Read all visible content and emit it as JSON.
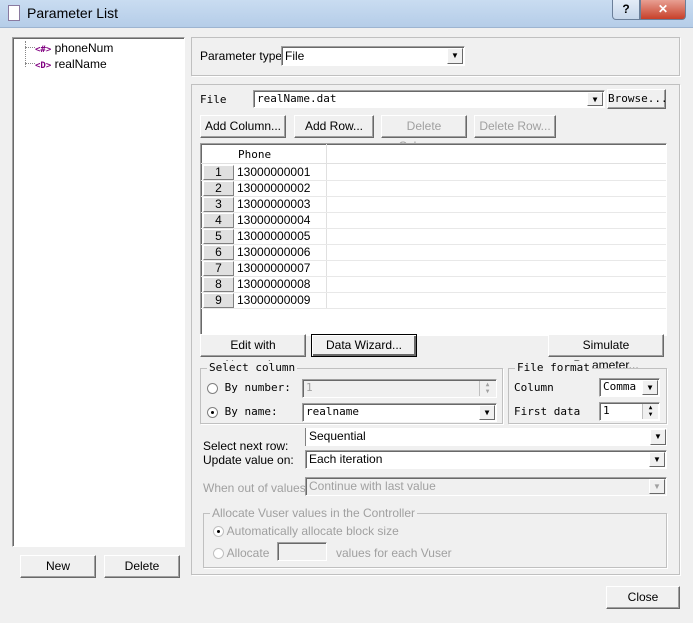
{
  "window": {
    "title": "Parameter List",
    "help": "?",
    "close": "✕"
  },
  "tree": {
    "items": [
      {
        "icon": "<#>",
        "label": "phoneNum"
      },
      {
        "icon": "<D>",
        "label": "realName"
      }
    ]
  },
  "left_buttons": {
    "new": "New",
    "delete": "Delete"
  },
  "param_type": {
    "label": "Parameter type:",
    "value": "File"
  },
  "file": {
    "label": "File",
    "value": "realName.dat",
    "browse": "Browse..."
  },
  "toolbar": {
    "add_column": "Add Column...",
    "add_row": "Add Row...",
    "delete_column": "Delete Column...",
    "delete_row": "Delete Row..."
  },
  "table": {
    "columns": [
      "Phone"
    ],
    "rows": [
      [
        "1",
        "13000000001"
      ],
      [
        "2",
        "13000000002"
      ],
      [
        "3",
        "13000000003"
      ],
      [
        "4",
        "13000000004"
      ],
      [
        "5",
        "13000000005"
      ],
      [
        "6",
        "13000000006"
      ],
      [
        "7",
        "13000000007"
      ],
      [
        "8",
        "13000000008"
      ],
      [
        "9",
        "13000000009"
      ]
    ]
  },
  "actions": {
    "edit_notepad": "Edit with Notepad...",
    "data_wizard": "Data Wizard...",
    "simulate": "Simulate Parameter..."
  },
  "select_column": {
    "title": "Select column",
    "by_number": "By number:",
    "number_value": "1",
    "by_name": "By name:",
    "name_value": "realname",
    "selected": "by_name"
  },
  "file_format": {
    "title": "File format",
    "column_label": "Column",
    "column_value": "Comma",
    "first_data_label": "First data",
    "first_data_value": "1"
  },
  "select_next_row": {
    "label": "Select next row:",
    "value": "Sequential"
  },
  "update_value": {
    "label": "Update value on:",
    "value": "Each iteration"
  },
  "out_of_values": {
    "label": "When out of values:",
    "value": "Continue with last value"
  },
  "allocate": {
    "title": "Allocate Vuser values in the Controller",
    "auto": "Automatically allocate block size",
    "allocate": "Allocate",
    "suffix": "values for each Vuser",
    "selected": "auto"
  },
  "close_button": "Close"
}
